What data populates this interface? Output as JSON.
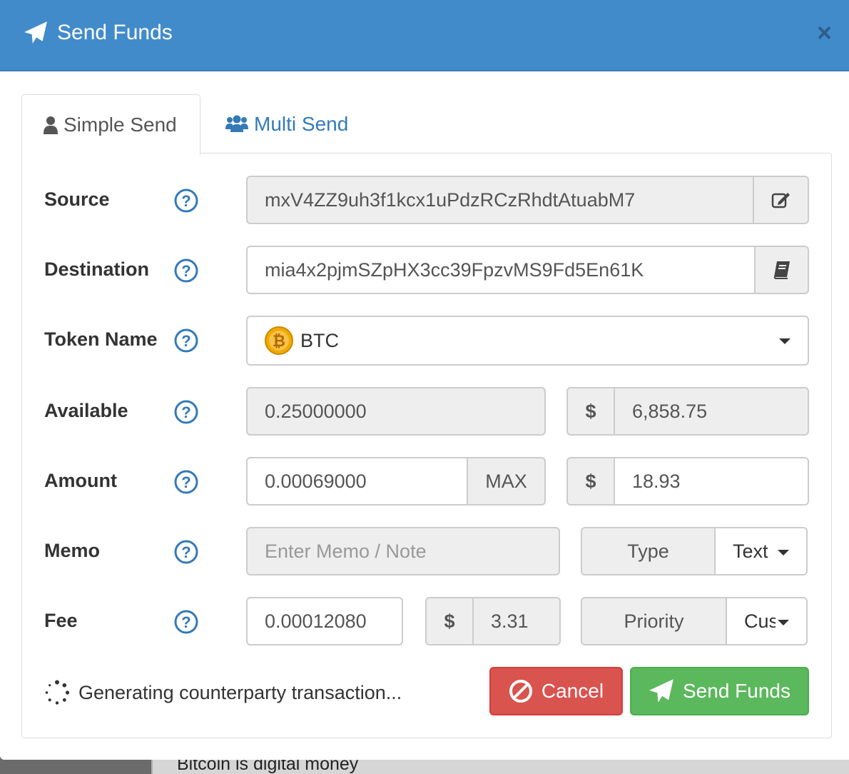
{
  "background": {
    "text": "Bitcoin is digital money"
  },
  "modal": {
    "title": "Send Funds",
    "close_label": "×"
  },
  "tabs": [
    {
      "label": "Simple Send",
      "icon": "user-icon",
      "active": true
    },
    {
      "label": "Multi Send",
      "icon": "users-icon",
      "active": false
    }
  ],
  "form": {
    "source": {
      "label": "Source",
      "value": "mxV4ZZ9uh3f1kcx1uPdzRCzRhdtAtuabM7",
      "button_icon": "edit-icon"
    },
    "destination": {
      "label": "Destination",
      "value": "mia4x2pjmSZpHX3cc39FpzvMS9Fd5En61K",
      "button_icon": "address-book-icon"
    },
    "token": {
      "label": "Token Name",
      "value": "BTC",
      "icon": "bitcoin-icon"
    },
    "available": {
      "label": "Available",
      "value": "0.25000000",
      "currency": "$",
      "usd": "6,858.75"
    },
    "amount": {
      "label": "Amount",
      "value": "0.00069000",
      "max_label": "MAX",
      "currency": "$",
      "usd": "18.93"
    },
    "memo": {
      "label": "Memo",
      "placeholder": "Enter Memo / Note",
      "type_label": "Type",
      "type_value": "Text"
    },
    "fee": {
      "label": "Fee",
      "value": "0.00012080",
      "currency": "$",
      "usd": "3.31",
      "priority_label": "Priority",
      "priority_value": "Cus"
    }
  },
  "footer": {
    "status": "Generating counterparty transaction...",
    "cancel_label": "Cancel",
    "send_label": "Send Funds"
  },
  "colors": {
    "header": "#428bca",
    "link": "#337ab7",
    "cancel": "#d9534f",
    "send": "#5cb85c"
  }
}
